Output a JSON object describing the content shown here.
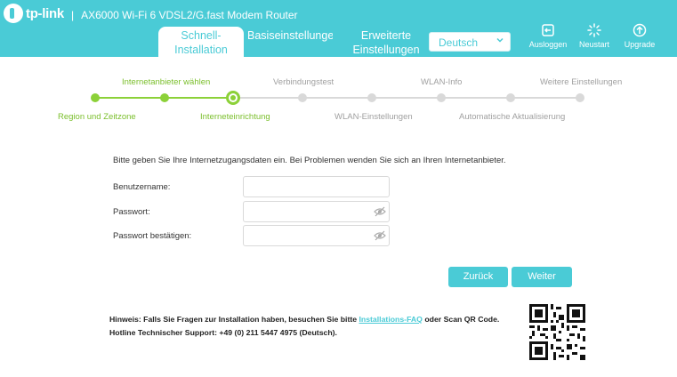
{
  "brand": {
    "logo_text": "tp-link",
    "model_title": "AX6000 Wi-Fi 6 VDSL2/G.fast Modem Router",
    "separator": "|"
  },
  "tabs": [
    {
      "label": "Schnell-Installation",
      "active": true
    },
    {
      "label": "Basiseinstellungen",
      "active": false
    },
    {
      "label": "Erweiterte Einstellungen",
      "active": false
    }
  ],
  "language": {
    "selected": "Deutsch"
  },
  "header_buttons": [
    {
      "label": "Ausloggen",
      "icon": "logout-icon"
    },
    {
      "label": "Neustart",
      "icon": "reboot-icon"
    },
    {
      "label": "Upgrade",
      "icon": "upgrade-icon"
    }
  ],
  "steps": [
    {
      "label": "Region und Zeitzone",
      "state": "done"
    },
    {
      "label": "Internetanbieter wählen",
      "state": "done"
    },
    {
      "label": "Interneteinrichtung",
      "state": "current"
    },
    {
      "label": "Verbindungstest",
      "state": "todo"
    },
    {
      "label": "WLAN-Einstellungen",
      "state": "todo"
    },
    {
      "label": "WLAN-Info",
      "state": "todo"
    },
    {
      "label": "Automatische Aktualisierung",
      "state": "todo"
    },
    {
      "label": "Weitere Einstellungen",
      "state": "todo"
    }
  ],
  "form": {
    "intro": "Bitte geben Sie Ihre Internetzugangsdaten ein. Bei Problemen wenden Sie sich an Ihren Internetanbieter.",
    "username_label": "Benutzername:",
    "username_value": "",
    "password_label": "Passwort:",
    "password_value": "",
    "confirm_label": "Passwort bestätigen:",
    "confirm_value": ""
  },
  "actions": {
    "back": "Zurück",
    "next": "Weiter"
  },
  "note": {
    "line1_prefix": "Hinweis: Falls Sie Fragen zur Installation haben, besuchen Sie bitte ",
    "link": "Installations-FAQ",
    "line1_suffix": " oder Scan QR Code.",
    "line2": "Hotline Technischer Support: +49 (0) 211 5447 4975 (Deutsch)."
  },
  "colors": {
    "accent": "#4acbd6",
    "done": "#8cd138",
    "pending": "#d9d9d9"
  }
}
